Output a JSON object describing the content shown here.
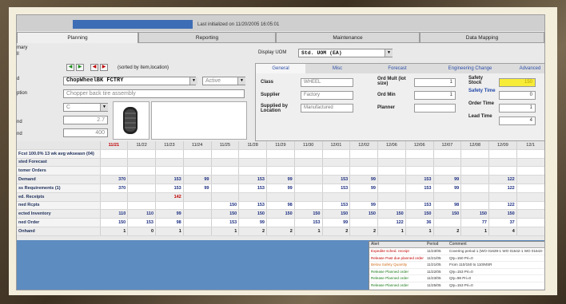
{
  "top": {
    "item_field": "",
    "last_updated": "Last initialized on 11/20/2005  16:05:01"
  },
  "tabs": [
    "Planning",
    "Reporting",
    "Maintenance",
    "Data Mapping"
  ],
  "left_labels": [
    "mary",
    "ll",
    "d",
    "ption",
    "nd",
    "nd"
  ],
  "sorted_label": "(sorted by item,location)",
  "item_code": "ChopWheelBK        FCTRY",
  "status": "Active",
  "description": "Chopper back tire assembly",
  "small_fields": [
    "C",
    "2.7",
    "400"
  ],
  "display_uom_label": "Display UOM",
  "display_uom": "Std. UOM (EA)",
  "panel": {
    "tabs": [
      "General",
      "Misc",
      "Forecast",
      "Engineering Change",
      "Advanced"
    ],
    "class_label": "Class",
    "class_value": "WHEEL",
    "supplier_label": "Supplier",
    "supplier_value": "Factory",
    "supplied_label": "Supplied by Location",
    "supplied_value": "Manufactured",
    "ord_mult_label": "Ord Mult (lot size)",
    "ord_mult_value": "1",
    "ord_min_label": "Ord Min",
    "ord_min_value": "1",
    "planner_label": "Planner",
    "safety_stock_label": "Safety Stock",
    "safety_stock_value": "150",
    "safety_time_label": "Safety Time",
    "safety_time_value": "0",
    "order_time_label": "Order Time",
    "order_time_value": "1",
    "lead_time_label": "Lead Time",
    "lead_time_value": "4"
  },
  "grid": {
    "dates": [
      "11/21",
      "11/22",
      "11/23",
      "11/24",
      "11/25",
      "11/28",
      "11/29",
      "11/30",
      "12/01",
      "12/02",
      "12/06",
      "12/06",
      "12/07",
      "12/08",
      "12/09",
      "12/1"
    ],
    "rows": [
      {
        "label": "Fcst 100.0% 13 wk avg wkseasn (04)",
        "values": [
          "",
          "",
          "",
          "",
          "",
          "",
          "",
          "",
          "",
          "",
          "",
          "",
          "",
          "",
          "",
          ""
        ]
      },
      {
        "label": "sted Forecast",
        "values": [
          "",
          "",
          "",
          "",
          "",
          "",
          "",
          "",
          "",
          "",
          "",
          "",
          "",
          "",
          "",
          ""
        ]
      },
      {
        "label": "tomer Orders",
        "values": [
          "",
          "",
          "",
          "",
          "",
          "",
          "",
          "",
          "",
          "",
          "",
          "",
          "",
          "",
          "",
          ""
        ]
      },
      {
        "label": "Demand",
        "values": [
          "370",
          "",
          "153",
          "99",
          "",
          "153",
          "99",
          "",
          "153",
          "99",
          "",
          "153",
          "99",
          "",
          "122",
          ""
        ]
      },
      {
        "label": "ss Requirements (1)",
        "values": [
          "370",
          "",
          "153",
          "99",
          "",
          "153",
          "99",
          "",
          "153",
          "99",
          "",
          "153",
          "99",
          "",
          "122",
          ""
        ]
      },
      {
        "label": "ed. Receipts",
        "values": [
          "",
          "",
          "142",
          "",
          "",
          "",
          "",
          "",
          "",
          "",
          "",
          "",
          "",
          "",
          "",
          ""
        ]
      },
      {
        "label": "ned Rcpts",
        "values": [
          "",
          "",
          "",
          "",
          "150",
          "153",
          "98",
          "",
          "153",
          "99",
          "",
          "153",
          "98",
          "",
          "122",
          ""
        ]
      },
      {
        "label": "ected Inventory",
        "values": [
          "110",
          "110",
          "99",
          "",
          "150",
          "150",
          "150",
          "150",
          "150",
          "150",
          "150",
          "150",
          "150",
          "150",
          "150",
          ""
        ]
      },
      {
        "label": "ned Order",
        "values": [
          "150",
          "153",
          "98",
          "",
          "153",
          "99",
          "",
          "153",
          "99",
          "",
          "122",
          "36",
          "",
          "77",
          "37",
          ""
        ]
      },
      {
        "label": "Onhand",
        "values": [
          "1",
          "0",
          "1",
          "",
          "1",
          "2",
          "2",
          "1",
          "2",
          "2",
          "1",
          "1",
          "2",
          "1",
          "4",
          ""
        ]
      }
    ]
  },
  "alerts": {
    "headers": [
      "Alert",
      "Period",
      "Comment"
    ],
    "rows": [
      {
        "alert": "Expedite sched. receipt",
        "period": "11/23/05",
        "comment": "Covering period 1 (WO 01639-1 WO 01642-1 WO 01643-",
        "color": "#c00000"
      },
      {
        "alert": "Release Past due planned order",
        "period": "11/21/05",
        "comment": "Qty=150  Pri=0",
        "color": "#c00000"
      },
      {
        "alert": "Below Safety Quantity",
        "period": "11/21/05",
        "comment": "From 110/150 to 110/MSR",
        "color": "#d07020"
      },
      {
        "alert": "Release Planned order",
        "period": "11/22/05",
        "comment": "Qty=153  Pri=0",
        "color": "#1a7a1a"
      },
      {
        "alert": "Release Planned order",
        "period": "11/23/05",
        "comment": "Qty=98  Pri=0",
        "color": "#1a7a1a"
      },
      {
        "alert": "Release Planned order",
        "period": "11/25/05",
        "comment": "Qty=153  Pri=0",
        "color": "#1a7a1a"
      }
    ]
  }
}
